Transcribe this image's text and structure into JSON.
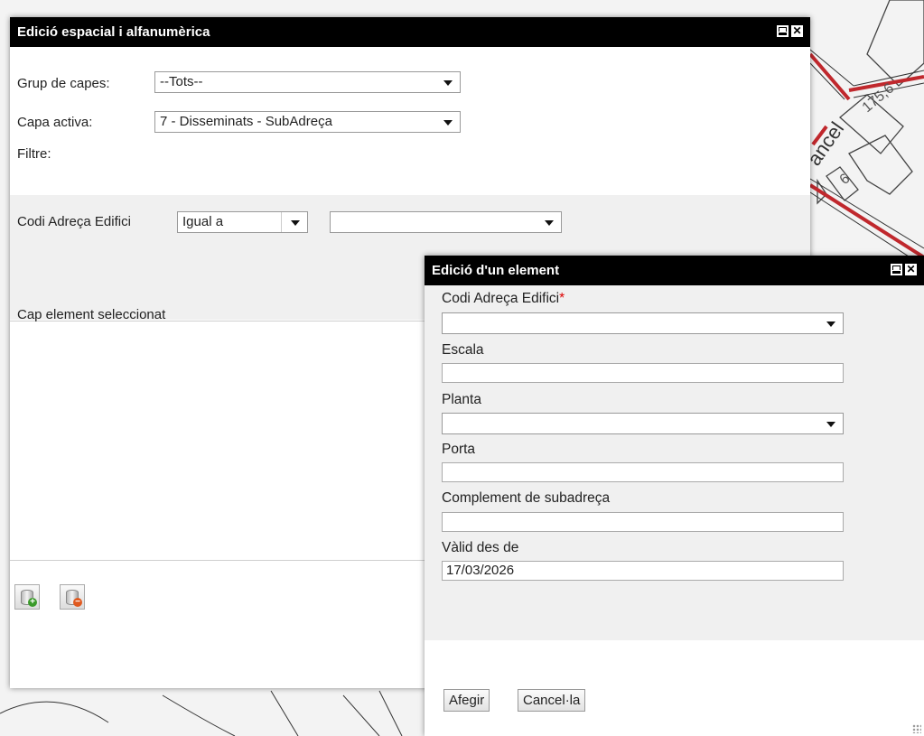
{
  "map": {
    "label_street": "ancel",
    "label_number_1": "175,6",
    "label_number_2": "6"
  },
  "main_window": {
    "title": "Edició espacial i alfanumèrica",
    "group_label": "Grup de capes:",
    "group_value": "--Tots--",
    "layer_label": "Capa activa:",
    "layer_value": "7 - Disseminats - SubAdreça",
    "filter_label": "Filtre:",
    "filter_field_label": "Codi Adreça Edifici",
    "filter_operator": "Igual a",
    "filter_value": "",
    "selection_status": "Cap element seleccionat"
  },
  "edit_window": {
    "title": "Edició d'un element",
    "fields": [
      {
        "label": "Codi Adreça Edifici",
        "required_mark": "*",
        "value": ""
      },
      {
        "label": "Escala",
        "value": ""
      },
      {
        "label": "Planta",
        "value": ""
      },
      {
        "label": "Porta",
        "value": ""
      },
      {
        "label": "Complement de subadreça",
        "value": ""
      },
      {
        "label": "Vàlid des de",
        "value": "17/03/2026"
      }
    ],
    "add_button": "Afegir",
    "cancel_button": "Cancel·la"
  },
  "colors": {
    "titlebar": "#000000",
    "panel_bg": "#f0f0f0",
    "road": "#c0282d",
    "required": "#dd0000",
    "add_badge": "#3a9a2a",
    "remove_badge": "#e05a20"
  },
  "icons": [
    "minimize-icon",
    "close-icon",
    "chevron-down-icon",
    "add-element-icon",
    "remove-element-icon",
    "resize-grip-icon"
  ]
}
